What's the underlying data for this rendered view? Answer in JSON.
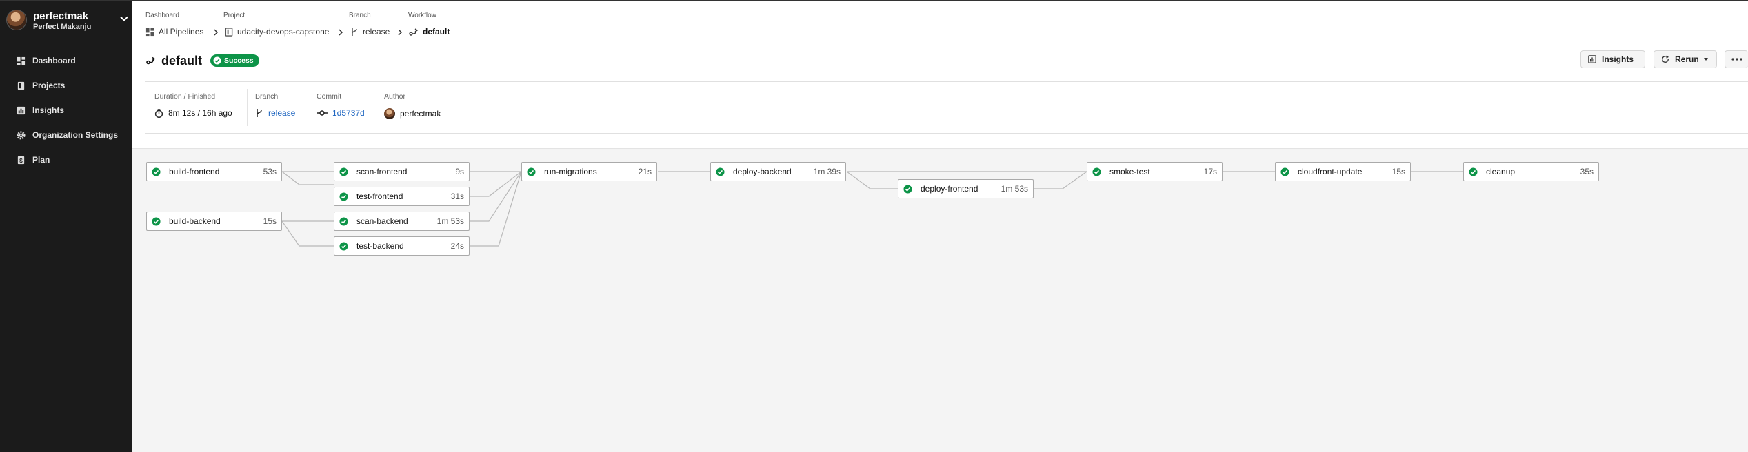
{
  "sidebar": {
    "org_name": "perfectmak",
    "org_user": "Perfect Makanju",
    "items": [
      {
        "label": "Dashboard",
        "icon": "dashboard-icon"
      },
      {
        "label": "Projects",
        "icon": "projects-icon"
      },
      {
        "label": "Insights",
        "icon": "insights-icon"
      },
      {
        "label": "Organization Settings",
        "icon": "gear-icon"
      },
      {
        "label": "Plan",
        "icon": "plan-icon"
      }
    ]
  },
  "breadcrumb": {
    "dashboard_label": "Dashboard",
    "dashboard_value": "All Pipelines",
    "project_label": "Project",
    "project_value": "udacity-devops-capstone",
    "branch_label": "Branch",
    "branch_value": "release",
    "workflow_label": "Workflow",
    "workflow_value": "default"
  },
  "workflow": {
    "title": "default",
    "status": "Success",
    "status_color": "#0d9448"
  },
  "actions": {
    "insights_label": "Insights",
    "rerun_label": "Rerun"
  },
  "details": {
    "duration_label": "Duration / Finished",
    "duration_value": "8m 12s / 16h ago",
    "branch_label": "Branch",
    "branch_value": "release",
    "commit_label": "Commit",
    "commit_value": "1d5737d",
    "author_label": "Author",
    "author_value": "perfectmak"
  },
  "jobs": [
    {
      "name": "build-frontend",
      "duration": "53s"
    },
    {
      "name": "build-backend",
      "duration": "15s"
    },
    {
      "name": "scan-frontend",
      "duration": "9s"
    },
    {
      "name": "test-frontend",
      "duration": "31s"
    },
    {
      "name": "scan-backend",
      "duration": "1m 53s"
    },
    {
      "name": "test-backend",
      "duration": "24s"
    },
    {
      "name": "run-migrations",
      "duration": "21s"
    },
    {
      "name": "deploy-backend",
      "duration": "1m 39s"
    },
    {
      "name": "deploy-frontend",
      "duration": "1m 53s"
    },
    {
      "name": "smoke-test",
      "duration": "17s"
    },
    {
      "name": "cloudfront-update",
      "duration": "15s"
    },
    {
      "name": "cleanup",
      "duration": "35s"
    }
  ]
}
